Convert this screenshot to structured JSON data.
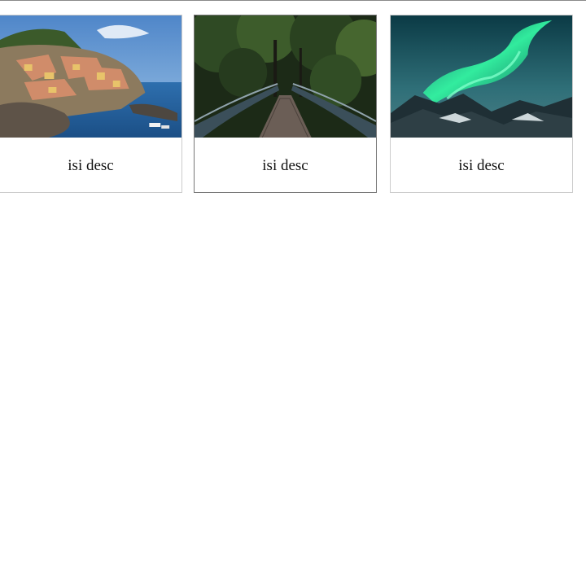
{
  "gallery": {
    "items": [
      {
        "image": "cinque-terre-coastal-village-photo",
        "desc": "isi desc"
      },
      {
        "image": "forest-footbridge-photo",
        "desc": "isi desc"
      },
      {
        "image": "northern-lights-mountains-photo",
        "desc": "isi desc"
      }
    ]
  },
  "colors": {
    "card_border": "#cccccc",
    "card_border_hover": "#777777",
    "text": "#111111"
  }
}
